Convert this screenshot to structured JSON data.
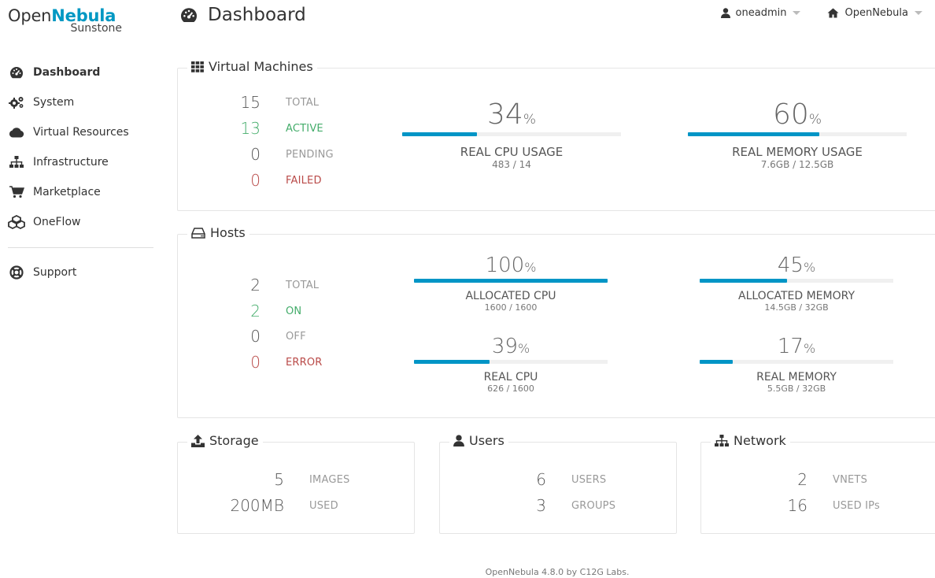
{
  "logo": {
    "prefix": "Open",
    "brand": "Nebula",
    "sub": "Sunstone"
  },
  "sidebar": {
    "items": [
      {
        "label": "Dashboard",
        "icon": "dashboard-icon"
      },
      {
        "label": "System",
        "icon": "cogs-icon"
      },
      {
        "label": "Virtual Resources",
        "icon": "cloud-icon"
      },
      {
        "label": "Infrastructure",
        "icon": "sitemap-icon"
      },
      {
        "label": "Marketplace",
        "icon": "shopping-cart-icon"
      },
      {
        "label": "OneFlow",
        "icon": "cubes-icon"
      }
    ],
    "support": {
      "label": "Support",
      "icon": "life-ring-icon"
    }
  },
  "header": {
    "title": "Dashboard",
    "user": "oneadmin",
    "zone": "OpenNebula"
  },
  "vms": {
    "title": "Virtual Machines",
    "stats": [
      {
        "value": "15",
        "label": "TOTAL"
      },
      {
        "value": "13",
        "label": "ACTIVE"
      },
      {
        "value": "0",
        "label": "PENDING"
      },
      {
        "value": "0",
        "label": "FAILED"
      }
    ],
    "cpu": {
      "value": "34",
      "pct": "%",
      "fill": 34,
      "title": "REAL CPU USAGE",
      "sub": "483 / 14"
    },
    "mem": {
      "value": "60",
      "pct": "%",
      "fill": 60,
      "title": "REAL MEMORY USAGE",
      "sub": "7.6GB / 12.5GB"
    }
  },
  "hosts": {
    "title": "Hosts",
    "stats": [
      {
        "value": "2",
        "label": "TOTAL"
      },
      {
        "value": "2",
        "label": "ON"
      },
      {
        "value": "0",
        "label": "OFF"
      },
      {
        "value": "0",
        "label": "ERROR"
      }
    ],
    "alloc_cpu": {
      "value": "100",
      "pct": "%",
      "fill": 100,
      "title": "ALLOCATED CPU",
      "sub": "1600 / 1600"
    },
    "alloc_mem": {
      "value": "45",
      "pct": "%",
      "fill": 45,
      "title": "ALLOCATED MEMORY",
      "sub": "14.5GB / 32GB"
    },
    "real_cpu": {
      "value": "39",
      "pct": "%",
      "fill": 39,
      "title": "REAL CPU",
      "sub": "626 / 1600"
    },
    "real_mem": {
      "value": "17",
      "pct": "%",
      "fill": 17,
      "title": "REAL MEMORY",
      "sub": "5.5GB / 32GB"
    }
  },
  "storage": {
    "title": "Storage",
    "stats": [
      {
        "value": "5",
        "label": "IMAGES"
      },
      {
        "value": "200MB",
        "label": "USED"
      }
    ]
  },
  "users": {
    "title": "Users",
    "stats": [
      {
        "value": "6",
        "label": "USERS"
      },
      {
        "value": "3",
        "label": "GROUPS"
      }
    ]
  },
  "network": {
    "title": "Network",
    "stats": [
      {
        "value": "2",
        "label": "VNETS"
      },
      {
        "value": "16",
        "label": "USED IPs"
      }
    ]
  },
  "footer": "OpenNebula 4.8.0 by C12G Labs.",
  "colors": {
    "brand": "#0098c3",
    "bar": "#0095c6",
    "green": "#43ac6a",
    "red": "#b94a48"
  }
}
